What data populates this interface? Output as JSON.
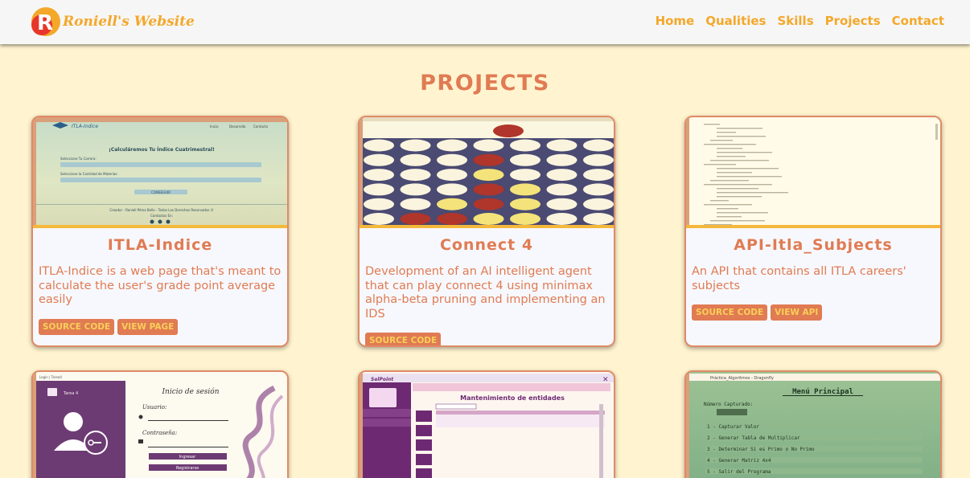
{
  "navbar": {
    "brand": "Roniell's Website",
    "logo_letter": "R",
    "links": [
      "Home",
      "Qualities",
      "Skills",
      "Projects",
      "Contact"
    ]
  },
  "section": {
    "title": "PROJECTS"
  },
  "projects": [
    {
      "title": "ITLA-Indice",
      "description": "ITLA-Indice is a web page that's meant to calculate the user's grade point average easily",
      "buttons": [
        "SOURCE CODE",
        "VIEW PAGE"
      ],
      "preview": {
        "brand": "ITLA-Indice",
        "nav": [
          "Inicio",
          "Desarrollo",
          "Contacto"
        ],
        "heading": "¡Calculáremos Tu Índice Cuatrimestral!",
        "label1": "Seleccione Tu Carrera:",
        "label2": "Seleccione la Cantidad de Materias:",
        "button": "CONSEGUIR",
        "footer": "Creador - Roniell Pérez Bello - Todos Los Derechos Reservados ©",
        "footer2": "Contactos En:"
      }
    },
    {
      "title": "Connect 4",
      "description": "Development of an AI intelligent agent that can play connect 4 using minimax alpha-beta pruning and implementing an IDS",
      "buttons": [
        "SOURCE CODE"
      ]
    },
    {
      "title": "API-Itla_Subjects",
      "description": "An API that contains all ITLA careers' subjects",
      "buttons": [
        "SOURCE CODE",
        "VIEW API"
      ]
    }
  ],
  "previews_row2": {
    "login": {
      "window_title": "Login | Tarea4",
      "side_label": "Tarea 4",
      "heading": "Inicio de sesión",
      "user_label": "Usuario:",
      "pass_label": "Contraseña:",
      "btn_login": "Ingresar",
      "btn_register": "Registrarse"
    },
    "entities": {
      "logo": "SelPoint",
      "heading": "Mantenimiento de entidades"
    },
    "menu": {
      "window_title": "Práctica_Algoritmos - Dragonfly",
      "heading": "Menú Principal",
      "label": "Número Capturado:",
      "items": [
        "1 - Capturar Valor",
        "2 - Generar Tabla de Multiplicar",
        "3 - Determinar Si es Primo o No Primo",
        "4 - Generar Matriz 4x4",
        "5 - Salir del Programa"
      ]
    }
  },
  "colors": {
    "background": "#fff4cf",
    "accent": "#e07b53",
    "nav_gold": "#f4a82a",
    "card_bg": "#f7f8fd"
  }
}
